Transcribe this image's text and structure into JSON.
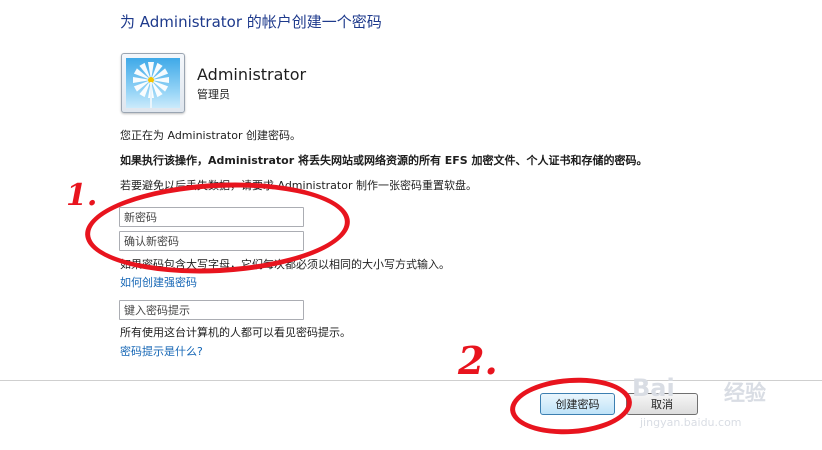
{
  "dialog": {
    "title": "为 Administrator 的帐户创建一个密码",
    "user": {
      "name": "Administrator",
      "role": "管理员"
    },
    "intro_text": "您正在为 Administrator 创建密码。",
    "warning_text": "如果执行该操作，Administrator 将丢失网站或网络资源的所有 EFS 加密文件、个人证书和存储的密码。",
    "reset_disk_text": "若要避免以后丢失数据，请要求 Administrator 制作一张密码重置软盘。",
    "new_password": {
      "placeholder": "新密码",
      "value": ""
    },
    "confirm_password": {
      "placeholder": "确认新密码",
      "value": ""
    },
    "case_note": "如果密码包含大写字母，它们每次都必须以相同的大小写方式输入。",
    "strong_password_link": "如何创建强密码",
    "hint": {
      "placeholder": "键入密码提示",
      "value": ""
    },
    "hint_note": "所有使用这台计算机的人都可以看见密码提示。",
    "hint_link": "密码提示是什么?",
    "buttons": {
      "create": "创建密码",
      "cancel": "取消"
    }
  },
  "annotations": {
    "step1": "1.",
    "step2": "2.",
    "color": "#e8141e"
  },
  "watermark": {
    "brand": "Bai",
    "brand_cn": "经验",
    "url": "jingyan.baidu.com"
  }
}
